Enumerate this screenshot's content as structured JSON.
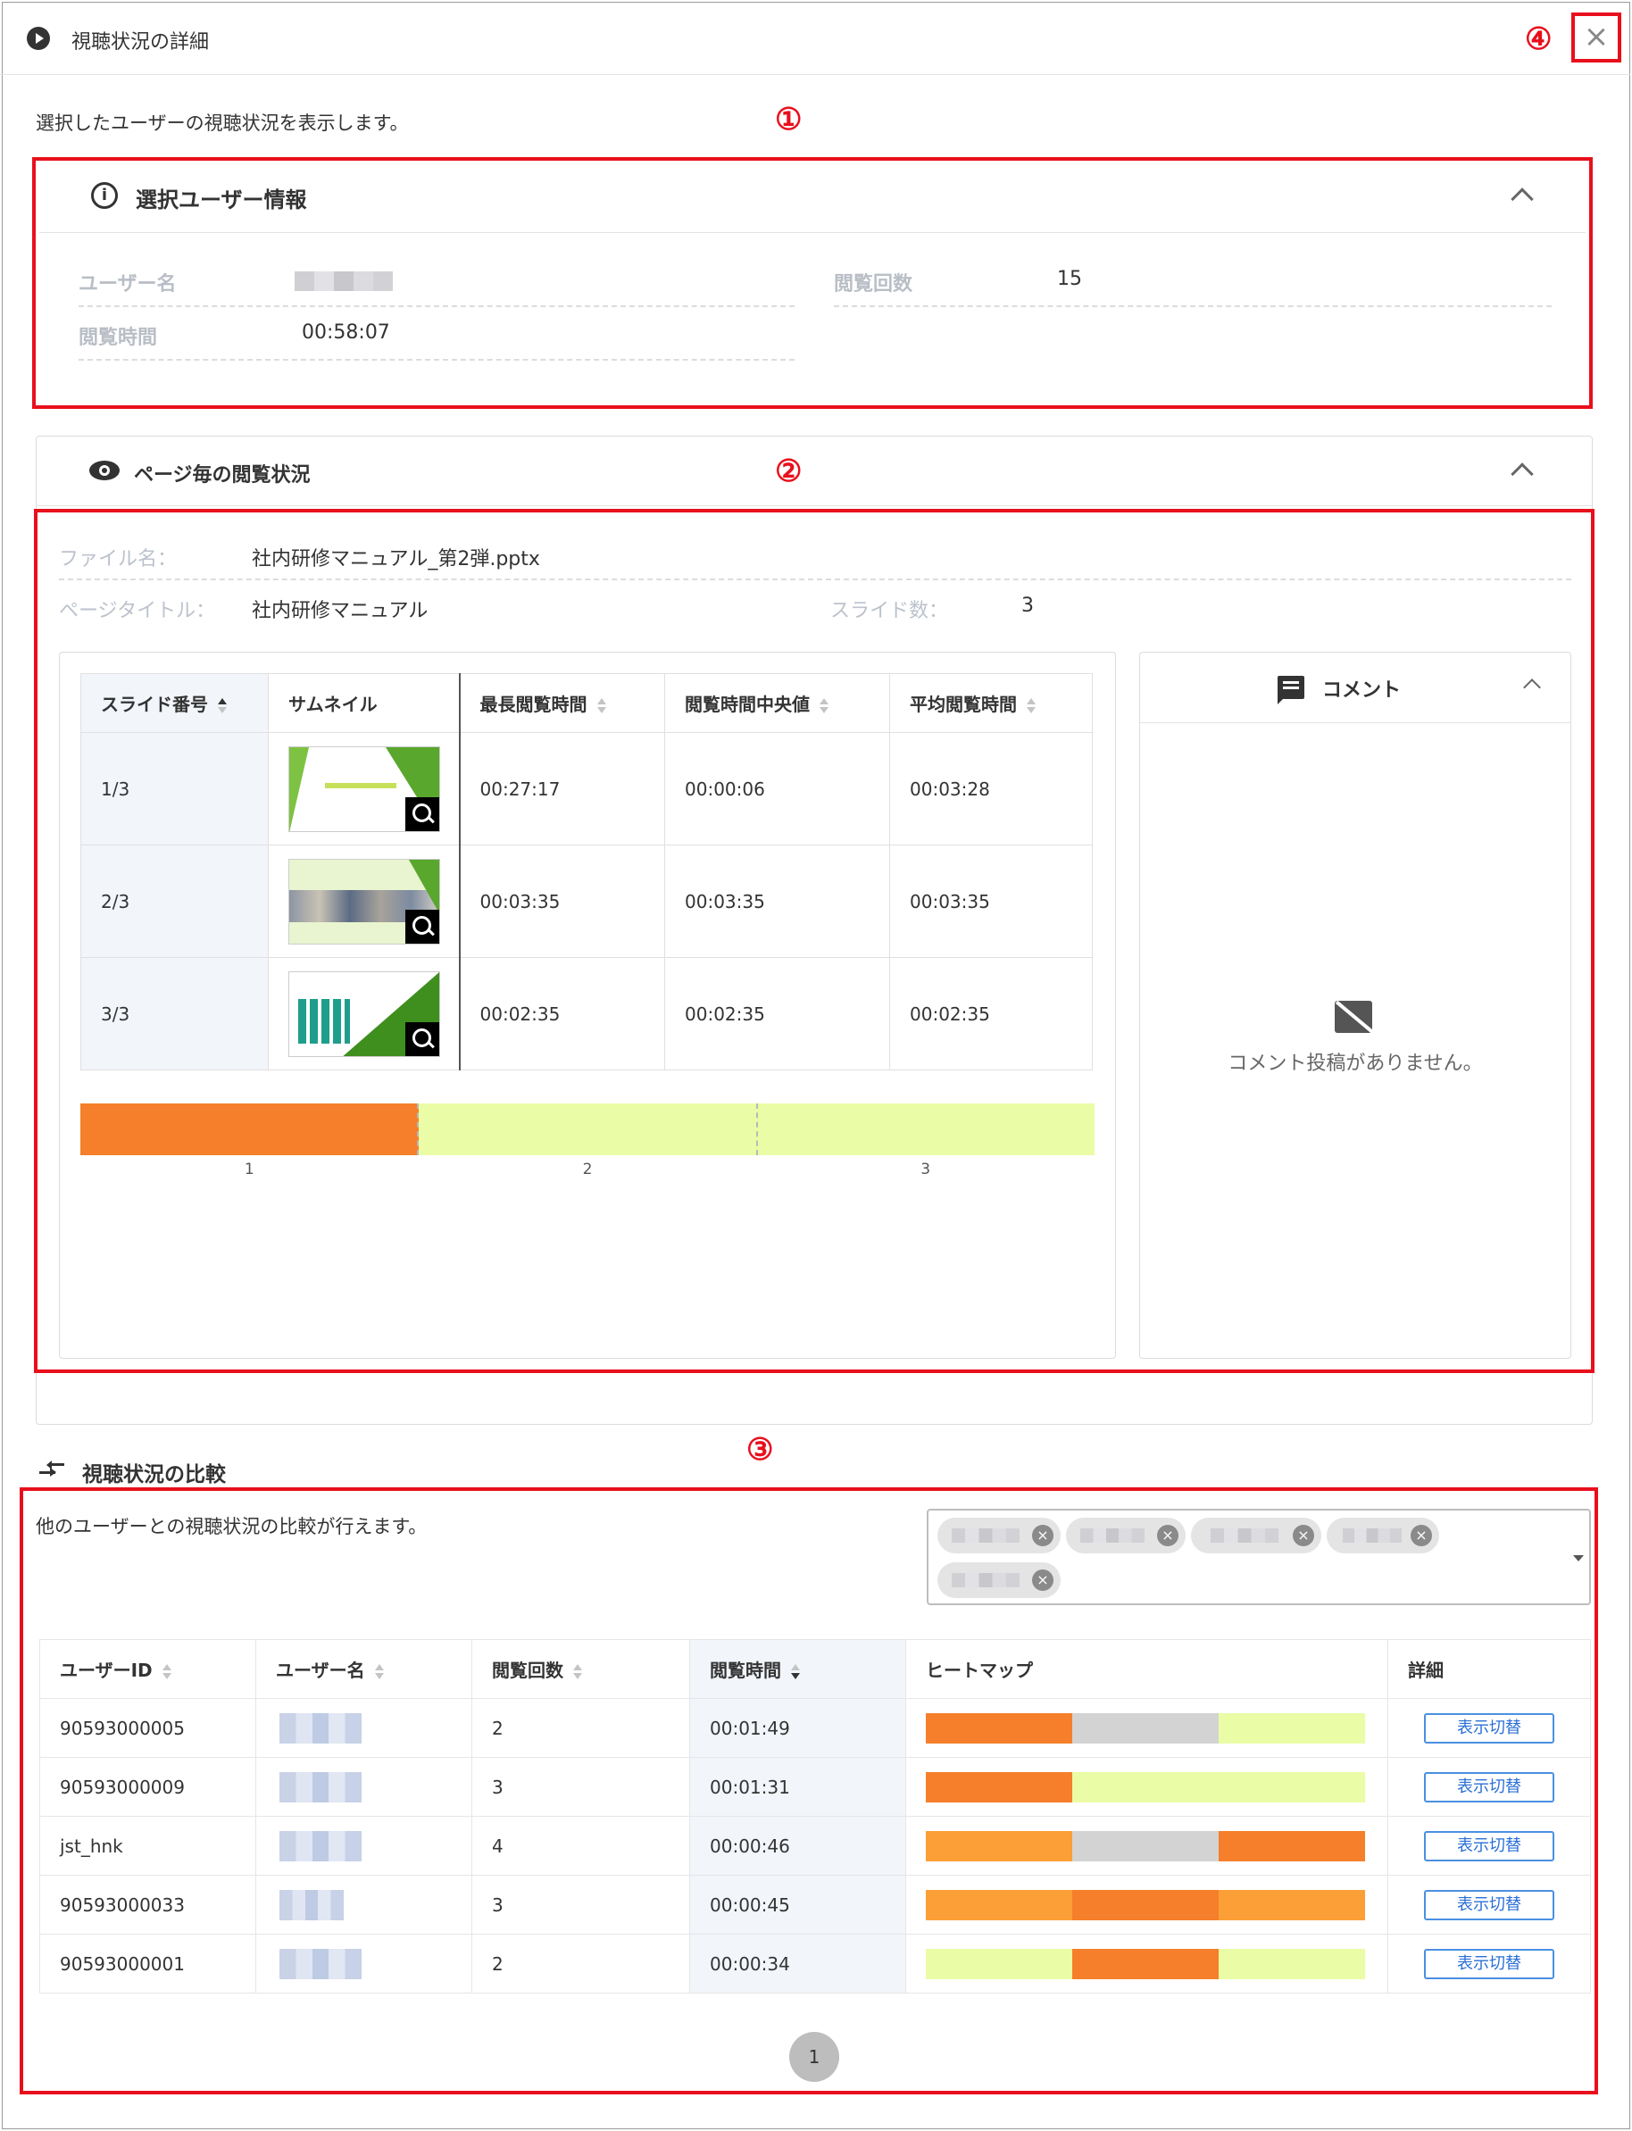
{
  "dialog": {
    "title": "視聴状況の詳細",
    "description": "選択したユーザーの視聴状況を表示します。",
    "close_label": "×"
  },
  "annotations": {
    "n1": "①",
    "n2": "②",
    "n3": "③",
    "n4": "④"
  },
  "user_info": {
    "title": "選択ユーザー情報",
    "username_label": "ユーザー名",
    "view_count_label": "閲覧回数",
    "view_count": "15",
    "view_time_label": "閲覧時間",
    "view_time": "00:58:07"
  },
  "page_status": {
    "title": "ページ毎の閲覧状況",
    "file_label": "ファイル名：",
    "file_name": "社内研修マニュアル_第2弾.pptx",
    "page_title_label": "ページタイトル：",
    "page_title": "社内研修マニュアル",
    "slide_count_label": "スライド数：",
    "slide_count": "3",
    "columns": [
      "スライド番号",
      "サムネイル",
      "最長閲覧時間",
      "閲覧時間中央値",
      "平均閲覧時間"
    ],
    "rows": [
      {
        "slide": "1/3",
        "max": "00:27:17",
        "median": "00:00:06",
        "avg": "00:03:28"
      },
      {
        "slide": "2/3",
        "max": "00:03:35",
        "median": "00:03:35",
        "avg": "00:03:35"
      },
      {
        "slide": "3/3",
        "max": "00:02:35",
        "median": "00:02:35",
        "avg": "00:02:35"
      }
    ],
    "bar_labels": [
      "1",
      "2",
      "3"
    ],
    "bar_colors": [
      "#f57f2a",
      "#eafca5",
      "#eafca5"
    ]
  },
  "comments": {
    "title": "コメント",
    "empty_text": "コメント投稿がありません。"
  },
  "compare": {
    "title": "視聴状況の比較",
    "description": "他のユーザーとの視聴状況の比較が行えます。",
    "columns": [
      "ユーザーID",
      "ユーザー名",
      "閲覧回数",
      "閲覧時間",
      "ヒートマップ",
      "詳細"
    ],
    "rows": [
      {
        "id": "90593000005",
        "count": "2",
        "time": "00:01:49",
        "heat": [
          "#f57f2a",
          "#d3d3d3",
          "#eafca5"
        ]
      },
      {
        "id": "90593000009",
        "count": "3",
        "time": "00:01:31",
        "heat": [
          "#f57f2a",
          "#eafca5",
          "#eafca5"
        ]
      },
      {
        "id": "jst_hnk",
        "count": "4",
        "time": "00:00:46",
        "heat": [
          "#fb9f36",
          "#d3d3d3",
          "#f57f2a"
        ]
      },
      {
        "id": "90593000033",
        "count": "3",
        "time": "00:00:45",
        "heat": [
          "#fb9f36",
          "#f57f2a",
          "#fb9f36"
        ]
      },
      {
        "id": "90593000001",
        "count": "2",
        "time": "00:00:34",
        "heat": [
          "#eafca5",
          "#f57f2a",
          "#eafca5"
        ]
      }
    ],
    "detail_button": "表示切替",
    "page": "1"
  },
  "colors": {
    "accent_red": "#e8101c",
    "link_blue": "#2a6fd6"
  }
}
